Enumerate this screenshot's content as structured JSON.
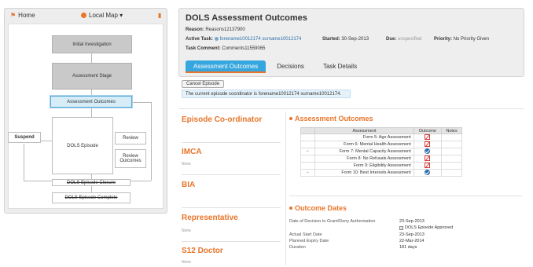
{
  "nav": {
    "home": "Home",
    "local_map": "Local Map",
    "dropdown_glyph": "▾",
    "pin_glyph": "▮"
  },
  "map": {
    "initial_investigation": "Initial Investigation",
    "assessment_stage": "Assessment Stage",
    "assessment_outcomes": "Assessment Outcomes",
    "dols_episode": "DOLS Episode",
    "suspend": "Suspend",
    "review": "Review",
    "review_outcomes": "Review Outcomes",
    "closure": "DOLS Episode Closure",
    "complete": "DOLS Episode Complete"
  },
  "header": {
    "title": "DOLS Assessment Outcomes",
    "reason_label": "Reason:",
    "reason_value": "Reasons12137900",
    "active_task_label": "Active Task:",
    "active_task_value": "forename10012174 surname10012174",
    "started_label": "Started:",
    "started_value": "30-Sep-2013",
    "due_label": "Due:",
    "due_value": "unspecified",
    "priority_label": "Priority:",
    "priority_value": "No Priority Given",
    "task_comment_label": "Task Comment:",
    "task_comment_value": "Comments11559065"
  },
  "tabs": [
    {
      "label": "Assessment Outcomes"
    },
    {
      "label": "Decisions"
    },
    {
      "label": "Task Details"
    }
  ],
  "cancel_episode": "Cancel Episode",
  "notice": "The current episode coordinator is forename10012174 surname10012174.",
  "left_sections": {
    "coordinator": "Episode Co-ordinator",
    "imca": "IMCA",
    "imca_value": "None",
    "bia": "BIA",
    "representative": "Representative",
    "representative_value": "None",
    "s12_doctor": "S12 Doctor",
    "s12_doctor_value": "None"
  },
  "assessment_outcomes": {
    "title": "Assessment Outcomes",
    "headers": [
      "Assessment",
      "Outcome",
      "Notes"
    ],
    "rows": [
      {
        "attachment": false,
        "name": "Form 5: Age Assessment",
        "outcome": "fail"
      },
      {
        "attachment": false,
        "name": "Form 6: Mental Health Assessment",
        "outcome": "fail"
      },
      {
        "attachment": true,
        "name": "Form 7: Mental Capacity Assessment",
        "outcome": "pass"
      },
      {
        "attachment": false,
        "name": "Form 8: No Refusals Assessment",
        "outcome": "fail"
      },
      {
        "attachment": false,
        "name": "Form 9: Eligibility Assessment",
        "outcome": "fail"
      },
      {
        "attachment": true,
        "name": "Form 10: Best Interests Assessment",
        "outcome": "pass"
      }
    ]
  },
  "outcome_dates": {
    "title": "Outcome Dates",
    "decision_label": "Date of Decision to Grant/Deny Authorisation",
    "decision_value": "23-Sep-2013",
    "approved_label": "DOLS Episode Approved",
    "approved_glyph": "✓",
    "actual_start_label": "Actual Start Date",
    "actual_start_value": "23-Sep-2013",
    "planned_expiry_label": "Planned Expiry Date",
    "planned_expiry_value": "22-Mar-2014",
    "duration_label": "Duration",
    "duration_value": "181 days"
  },
  "colors": {
    "accent": "#e8752a",
    "tab_active": "#36a6de",
    "link": "#2d6fa8"
  }
}
